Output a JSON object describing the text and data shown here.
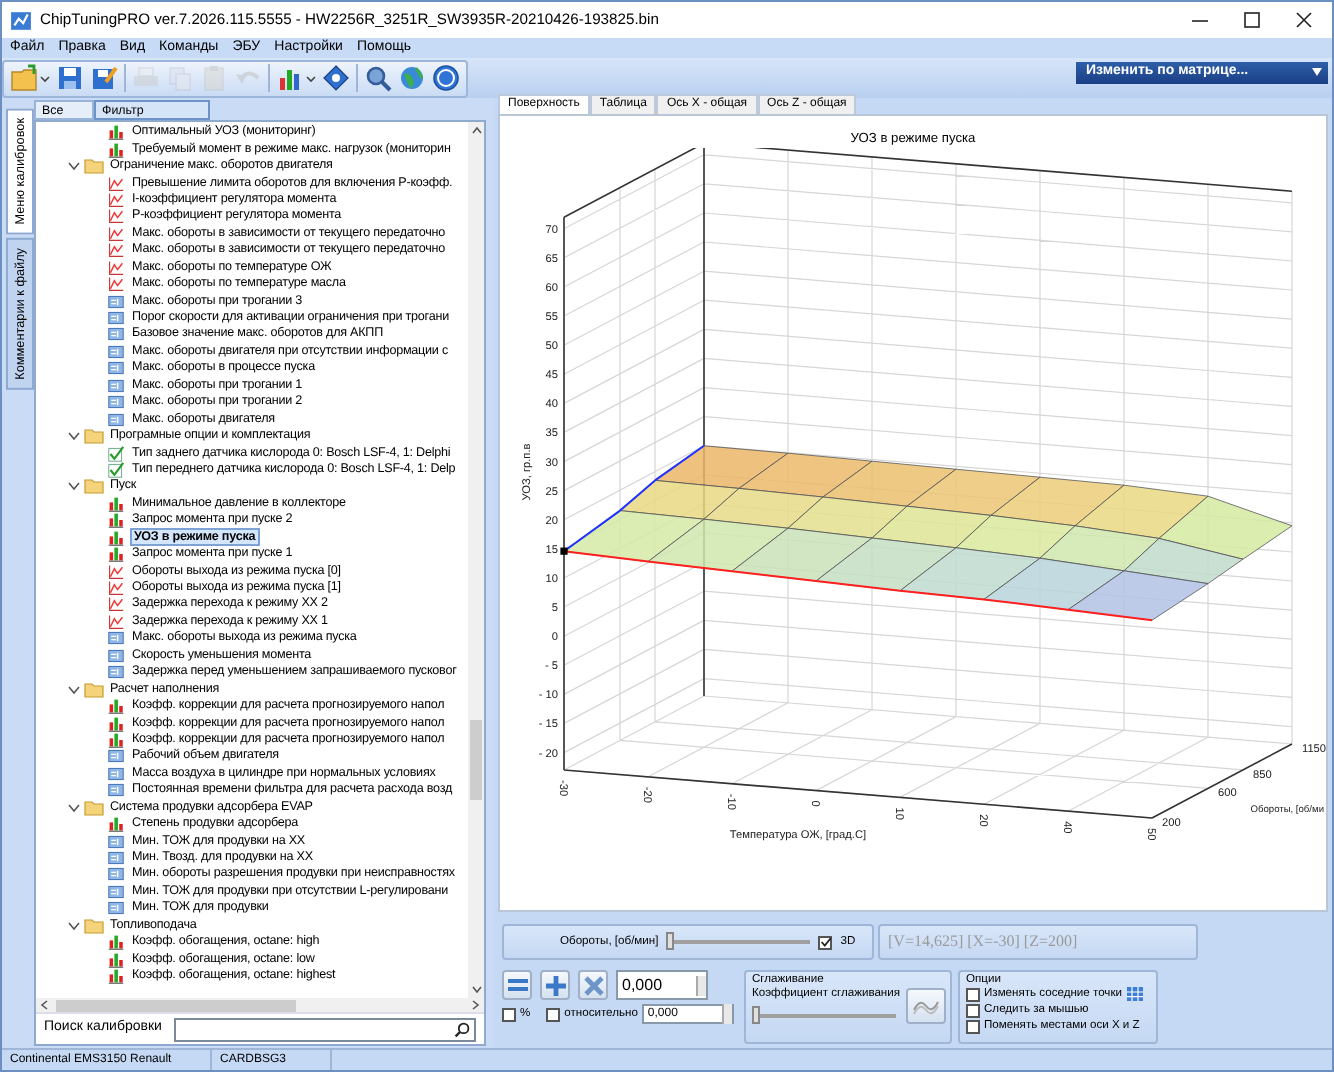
{
  "window": {
    "title": "ChipTuningPRO ver.7.2026.115.5555 - HW2256R_3251R_SW3935R-20210426-193825.bin"
  },
  "menu": [
    "Файл",
    "Правка",
    "Вид",
    "Команды",
    "ЭБУ",
    "Настройки",
    "Помощь"
  ],
  "toolbar": [
    {
      "kind": "open",
      "disabled": false,
      "dropdown": true
    },
    {
      "kind": "save",
      "disabled": false,
      "dropdown": false
    },
    {
      "kind": "save_as",
      "disabled": false,
      "dropdown": false
    },
    {
      "kind": "print",
      "disabled": true,
      "dropdown": false
    },
    {
      "kind": "copy",
      "disabled": true,
      "dropdown": false
    },
    {
      "kind": "paste",
      "disabled": true,
      "dropdown": false
    },
    {
      "kind": "undo",
      "disabled": true,
      "dropdown": false
    },
    {
      "kind": "chart",
      "disabled": false,
      "dropdown": true
    },
    {
      "kind": "diamond",
      "disabled": false,
      "dropdown": false
    },
    {
      "kind": "search",
      "disabled": false,
      "dropdown": false
    },
    {
      "kind": "globe",
      "disabled": false,
      "dropdown": false
    },
    {
      "kind": "help",
      "disabled": false,
      "dropdown": false
    }
  ],
  "matrix_dropdown": {
    "label": "Изменить по матрице..."
  },
  "side_tabs": [
    {
      "label": "Меню калибровок",
      "selected": true
    },
    {
      "label": "Комментарии к файлу",
      "selected": false
    }
  ],
  "tree_tabs": [
    {
      "label": "Все",
      "selected": false
    },
    {
      "label": "Фильтр",
      "selected": true
    }
  ],
  "tree": [
    {
      "kind": "map3d",
      "label": "Оптимальный УОЗ (мониторинг)",
      "selected": false
    },
    {
      "kind": "map3d",
      "label": "Требуемый момент в режиме макс. нагрузок (мониторин",
      "selected": false
    },
    {
      "kind": "folder",
      "label": "Ограничение макс. оборотов двигателя",
      "selected": false,
      "expanded": true,
      "children": [
        {
          "kind": "map2d",
          "label": "Превышение лимита оборотов для включения P-коэфф.",
          "selected": false
        },
        {
          "kind": "map2d",
          "label": "I-коэффициент регулятора момента",
          "selected": false
        },
        {
          "kind": "map2d",
          "label": "P-коэффициент регулятора момента",
          "selected": false
        },
        {
          "kind": "map2d",
          "label": "Макс. обороты  в зависимости от текущего передаточно",
          "selected": false
        },
        {
          "kind": "map2d",
          "label": "Макс. обороты  в зависимости от текущего передаточно",
          "selected": false
        },
        {
          "kind": "map2d",
          "label": "Макс. обороты по температуре ОЖ",
          "selected": false
        },
        {
          "kind": "map2d",
          "label": "Макс. обороты по температуре масла",
          "selected": false
        },
        {
          "kind": "value",
          "label": "Макс. обороты при трогании 3",
          "selected": false
        },
        {
          "kind": "value",
          "label": "Порог скорости для активации ограничения при трогани",
          "selected": false
        },
        {
          "kind": "value",
          "label": "Базовое значение макс. оборотов для АКПП",
          "selected": false
        },
        {
          "kind": "value",
          "label": "Макс. обороты двигателя при отсутствии  информации с",
          "selected": false
        },
        {
          "kind": "value",
          "label": "Макс. обороты в процессе пуска",
          "selected": false
        },
        {
          "kind": "value",
          "label": "Макс. обороты при трогании 1",
          "selected": false
        },
        {
          "kind": "value",
          "label": "Макс. обороты при трогании 2",
          "selected": false
        },
        {
          "kind": "value",
          "label": "Макс. обороты двигателя",
          "selected": false
        }
      ]
    },
    {
      "kind": "folder",
      "label": "Програмные опции и комплектация",
      "selected": false,
      "expanded": true,
      "children": [
        {
          "kind": "flag",
          "label": "Тип заднего датчика кислорода 0: Bosch LSF-4, 1: Delphi",
          "selected": false
        },
        {
          "kind": "flag",
          "label": "Тип переднего датчика кислорода 0: Bosch LSF-4, 1: Delp",
          "selected": false
        }
      ]
    },
    {
      "kind": "folder",
      "label": "Пуск",
      "selected": false,
      "expanded": true,
      "children": [
        {
          "kind": "map3d",
          "label": "Минимальное давление в коллекторе",
          "selected": false
        },
        {
          "kind": "map3d",
          "label": "Запрос момента при пуске 2",
          "selected": false
        },
        {
          "kind": "map3d",
          "label": "УОЗ в режиме пуска",
          "selected": true
        },
        {
          "kind": "map3d",
          "label": "Запрос момента при пуске 1",
          "selected": false
        },
        {
          "kind": "map2d",
          "label": "Обороты выхода из режима пуска [0]",
          "selected": false
        },
        {
          "kind": "map2d",
          "label": "Обороты выхода из режима пуска [1]",
          "selected": false
        },
        {
          "kind": "map2d",
          "label": "Задержка перехода к режиму ХХ 2",
          "selected": false
        },
        {
          "kind": "map2d",
          "label": "Задержка перехода к режиму ХХ 1",
          "selected": false
        },
        {
          "kind": "value",
          "label": "Макс. обороты выхода из режима пуска",
          "selected": false
        },
        {
          "kind": "value",
          "label": "Скорость уменьшения момента",
          "selected": false
        },
        {
          "kind": "value",
          "label": "Задержка перед уменьшением запрашиваемого пусковог",
          "selected": false
        }
      ]
    },
    {
      "kind": "folder",
      "label": "Расчет наполнения",
      "selected": false,
      "expanded": true,
      "children": [
        {
          "kind": "map3d",
          "label": "Коэфф. коррекции для расчета прогнозируемого напол",
          "selected": false
        },
        {
          "kind": "map3d",
          "label": "Коэфф. коррекции для расчета прогнозируемого напол",
          "selected": false
        },
        {
          "kind": "map3d",
          "label": "Коэфф. коррекции для расчета прогнозируемого напол",
          "selected": false
        },
        {
          "kind": "value",
          "label": "Рабочий объем двигателя",
          "selected": false
        },
        {
          "kind": "value",
          "label": "Масса воздуха в цилиндре при нормальных условиях",
          "selected": false
        },
        {
          "kind": "value",
          "label": "Постоянная времени фильтра для расчета расхода возд",
          "selected": false
        }
      ]
    },
    {
      "kind": "folder",
      "label": "Система продувки адсорбера EVAP",
      "selected": false,
      "expanded": true,
      "children": [
        {
          "kind": "map3d",
          "label": "Степень продувки адсорбера",
          "selected": false
        },
        {
          "kind": "value",
          "label": "Мин. ТОЖ для продувки на ХХ",
          "selected": false
        },
        {
          "kind": "value",
          "label": "Мин. Твозд. для продувки на ХХ",
          "selected": false
        },
        {
          "kind": "value",
          "label": "Мин. обороты разрешения продувки при неисправностях",
          "selected": false
        },
        {
          "kind": "value",
          "label": "Мин. ТОЖ для продувки при отсутствии L-регулировани",
          "selected": false
        },
        {
          "kind": "value",
          "label": "Мин. ТОЖ для продувки",
          "selected": false
        }
      ]
    },
    {
      "kind": "folder",
      "label": "Топливоподача",
      "selected": false,
      "expanded": true,
      "children": [
        {
          "kind": "map3d",
          "label": "Коэфф. обогащения, octane: high",
          "selected": false
        },
        {
          "kind": "map3d",
          "label": "Коэфф. обогащения, octane: low",
          "selected": false
        },
        {
          "kind": "map3d",
          "label": "Коэфф. обогащения, octane: highest",
          "selected": false
        }
      ]
    }
  ],
  "search": {
    "label": "Поиск калибровки"
  },
  "view_tabs": [
    {
      "label": "Поверхность",
      "selected": true
    },
    {
      "label": "Таблица",
      "selected": false
    },
    {
      "label": "Ось X - общая",
      "selected": false
    },
    {
      "label": "Ось Z - общая",
      "selected": false
    }
  ],
  "chart": {
    "title": "УОЗ в режиме пуска",
    "y_label": "УОЗ, гр.п.в",
    "y_ticks": [
      "70",
      "65",
      "60",
      "55",
      "50",
      "45",
      "40",
      "35",
      "30",
      "25",
      "20",
      "15",
      "10",
      "5",
      "0",
      "- 5",
      "- 10",
      "- 15",
      "- 20"
    ],
    "x_label": "Температура ОЖ, [град.С]",
    "x_ticks": [
      "-30",
      "-20",
      "-10",
      "0",
      "10",
      "20",
      "40",
      "50"
    ],
    "z_label": "Обороты, [об/ми",
    "z_ticks": [
      "200",
      "600",
      "850",
      "1150"
    ]
  },
  "axis_slider": {
    "label": "Обороты, [об/мин]",
    "level": 0,
    "show_3d": {
      "label": "3D",
      "checked": true
    },
    "readout": "[V=14,625] [X=-30] [Z=200]"
  },
  "edit": {
    "buttons": [
      {
        "kind": "equals"
      },
      {
        "kind": "plus"
      },
      {
        "kind": "multiply"
      }
    ],
    "value": "0,000",
    "percent": {
      "label": "%",
      "checked": false
    },
    "relative": {
      "label": "относительно",
      "checked": false
    },
    "relative_value": "0,000"
  },
  "smoothing": {
    "title": "Сглаживание",
    "label": "Коэффициент сглаживания",
    "level": 0
  },
  "options": {
    "title": "Опции",
    "items": [
      {
        "label": "Изменять соседние точки",
        "checked": false
      },
      {
        "label": "Следить за мышью",
        "checked": false
      },
      {
        "label": "Поменять местами оси X и Z",
        "checked": false
      }
    ]
  },
  "status_bar": [
    "Continental EMS3150 Renault",
    "CARDBSG3"
  ]
}
